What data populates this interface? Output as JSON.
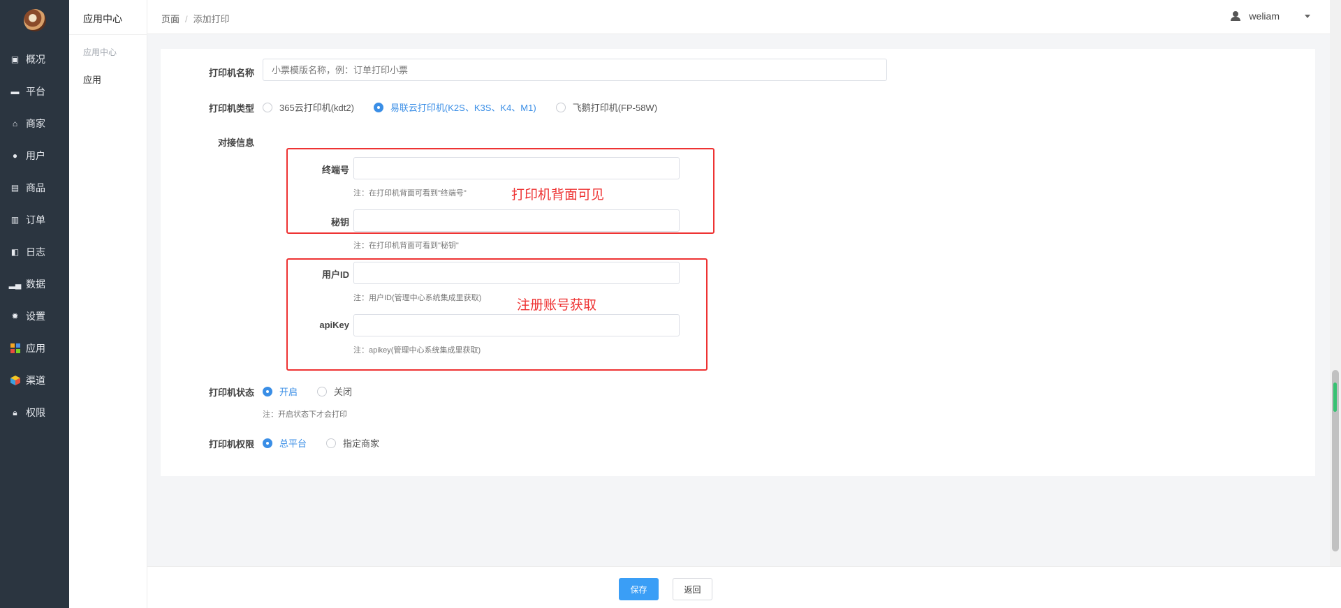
{
  "sidebar": {
    "items": [
      {
        "icon": "dashboard-icon",
        "label": "概况"
      },
      {
        "icon": "monitor-icon",
        "label": "平台"
      },
      {
        "icon": "store-icon",
        "label": "商家"
      },
      {
        "icon": "user-icon",
        "label": "用户"
      },
      {
        "icon": "product-icon",
        "label": "商品"
      },
      {
        "icon": "order-icon",
        "label": "订单"
      },
      {
        "icon": "log-icon",
        "label": "日志"
      },
      {
        "icon": "chart-icon",
        "label": "数据"
      },
      {
        "icon": "gear-icon",
        "label": "设置"
      },
      {
        "icon": "apps-icon",
        "label": "应用"
      },
      {
        "icon": "cube-icon",
        "label": "渠道"
      },
      {
        "icon": "lock-icon",
        "label": "权限"
      }
    ]
  },
  "subbar": {
    "title": "应用中心",
    "group": "应用中心",
    "link": "应用"
  },
  "header": {
    "crumb_root": "页面",
    "crumb_sep": "/",
    "crumb_current": "添加打印",
    "username": "weliam"
  },
  "form": {
    "name_label": "打印机名称",
    "name_placeholder": "小票模版名称，例：订单打印小票",
    "type_label": "打印机类型",
    "type_options": [
      "365云打印机(kdt2)",
      "易联云打印机(K2S、K3S、K4、M1)",
      "飞鹅打印机(FP-58W)"
    ],
    "type_selected": 1,
    "dock_label": "对接信息",
    "terminal_label": "终端号",
    "terminal_hint": "注：在打印机背面可看到\"终端号\"",
    "secret_label": "秘钥",
    "secret_hint": "注：在打印机背面可看到\"秘钥\"",
    "userid_label": "用户ID",
    "userid_hint": "注：用户ID(管理中心系统集成里获取)",
    "apikey_label": "apiKey",
    "apikey_hint": "注：apikey(管理中心系统集成里获取)",
    "status_label": "打印机状态",
    "status_options": [
      "开启",
      "关闭"
    ],
    "status_hint": "注：开启状态下才会打印",
    "perm_label": "打印机权限",
    "perm_options": [
      "总平台",
      "指定商家"
    ]
  },
  "annotations": {
    "box1_text": "打印机背面可见",
    "box2_text": "注册账号获取",
    "color": "#e33333"
  },
  "buttons": {
    "save": "保存",
    "back": "返回"
  },
  "colors": {
    "accent": "#3a8ee6",
    "sidebar_bg": "#2b3540"
  }
}
